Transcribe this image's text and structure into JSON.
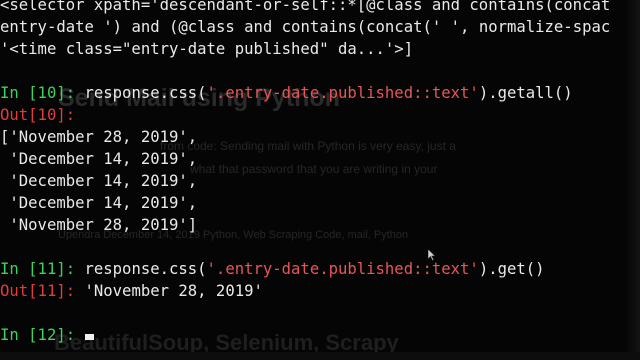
{
  "background_page": {
    "title": "Send Mail using Python",
    "excerpt_line1": "from code: Sending mail with Python is very easy, just a",
    "excerpt_line2": "what that password that you are writing in your",
    "excerpt_line3": "",
    "meta": "Upendra   December 14, 2019   Python, Web Scraping   Code, mail, Python",
    "next_title": "BeautifulSoup, Selenium, Scrapy"
  },
  "terminal": {
    "line1": "<selector xpath='descendant-or-self::*[@class and contains(concat",
    "line2_a": "entry-date ')",
    "line2_b": " and (@class and contains(concat(' ', normalize-spac",
    "line3": "'<time class=\"entry-date published\" da...'>]",
    "cells": [
      {
        "in_prompt": "In [10]:",
        "code_pre": " response.css(",
        "code_str": "'.entry-date.published::text'",
        "code_post": ").getall()",
        "out_prompt": "Out[10]:",
        "output_lines": [
          "['November 28, 2019',",
          " 'December 14, 2019',",
          " 'December 14, 2019',",
          " 'December 14, 2019',",
          " 'November 28, 2019']"
        ]
      },
      {
        "in_prompt": "In [11]:",
        "code_pre": " response.css(",
        "code_str": "'.entry-date.published::text'",
        "code_post": ").get()",
        "out_prompt": "Out[11]:",
        "output_inline": " 'November 28, 2019'"
      }
    ],
    "next_prompt": "In [12]:"
  },
  "colors": {
    "in_prompt": "#3fd15d",
    "out_prompt": "#e23b3b",
    "string": "#e85656",
    "text": "#eaeaea",
    "background": "#050505"
  }
}
